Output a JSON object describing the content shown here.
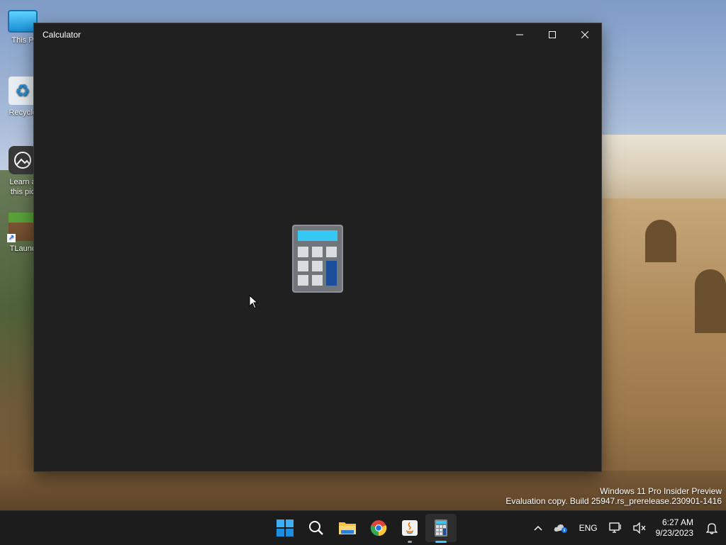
{
  "desktop": {
    "icons": [
      {
        "label": "This PC",
        "icon": "monitor-icon"
      },
      {
        "label": "Recycle Bin",
        "icon": "recycle-bin-icon"
      },
      {
        "label": "Learn about this picture",
        "icon": "camera-icon"
      },
      {
        "label": "TLauncher",
        "icon": "minecraft-block-icon"
      }
    ],
    "visible_labels": [
      "This P",
      "Recycle",
      "Learn a",
      "this pic",
      "TLaunc"
    ]
  },
  "window": {
    "title": "Calculator",
    "controls": {
      "minimize": "minimize-icon",
      "maximize": "maximize-icon",
      "close": "close-icon"
    },
    "splash_icon": "calculator-icon"
  },
  "watermark": {
    "line1": "Windows 11 Pro Insider Preview",
    "line2": "Evaluation copy. Build 25947.rs_prerelease.230901-1416"
  },
  "taskbar": {
    "apps": [
      "start-icon",
      "search-icon",
      "file-explorer-icon",
      "chrome-icon",
      "java-icon",
      "calculator-icon"
    ],
    "tray": {
      "language": "ENG",
      "time": "6:27 AM",
      "date": "9/23/2023"
    }
  },
  "colors": {
    "accent": "#4cc2ff",
    "window_bg": "#202020",
    "taskbar_bg": "#1c1c1c"
  }
}
